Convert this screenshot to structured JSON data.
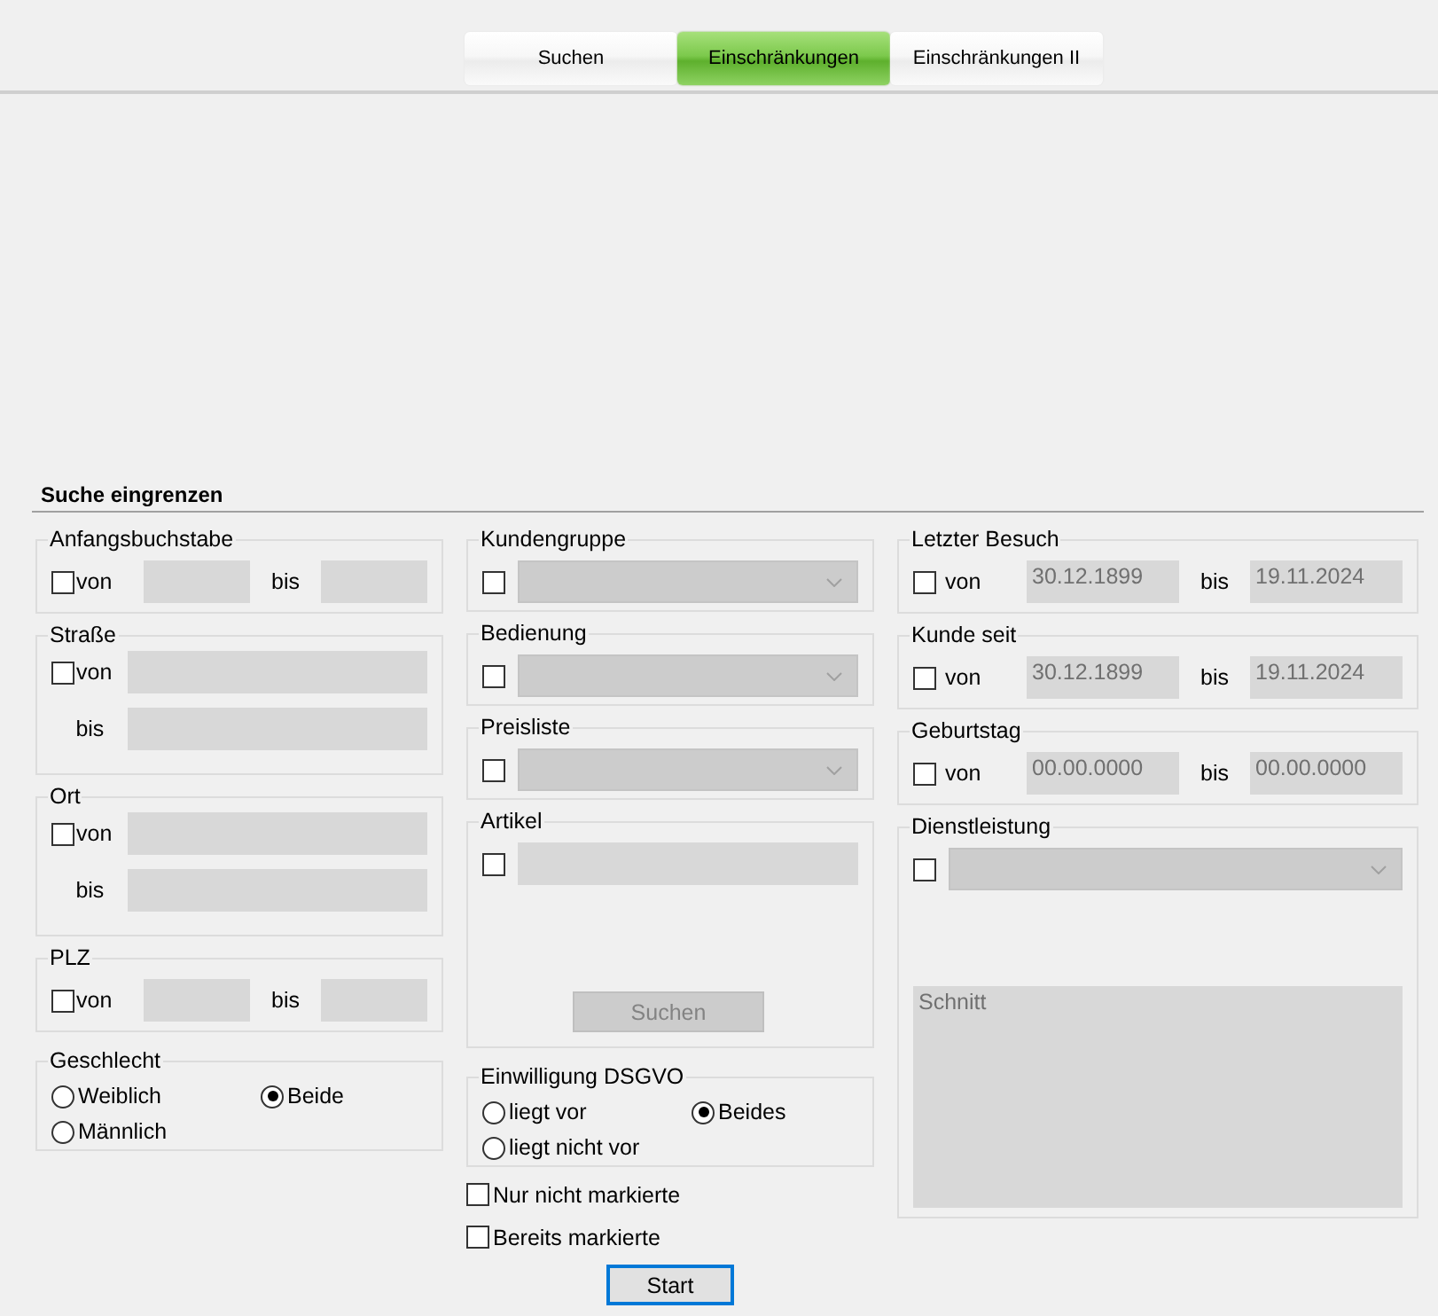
{
  "tabs": [
    {
      "label": "Suchen",
      "selected": false
    },
    {
      "label": "Einschränkungen",
      "selected": true
    },
    {
      "label": "Einschränkungen II",
      "selected": false
    }
  ],
  "section_title": "Suche eingrenzen",
  "columns": [
    {
      "groups": [
        {
          "kind": "range",
          "title": "Anfangsbuchstabe",
          "checkbox": {
            "label": "von",
            "checked": false
          },
          "from": {
            "disabled": true
          },
          "to_label": "bis",
          "to": {
            "disabled": true
          }
        },
        {
          "kind": "range_stacked",
          "title": "Straße",
          "checkbox": {
            "label": "von",
            "checked": false
          },
          "from": {
            "disabled": true
          },
          "to_label": "bis",
          "to": {
            "disabled": true
          }
        },
        {
          "kind": "range_stacked",
          "title": "Ort",
          "checkbox": {
            "label": "von",
            "checked": false
          },
          "from": {
            "disabled": true
          },
          "to_label": "bis",
          "to": {
            "disabled": true
          }
        },
        {
          "kind": "range",
          "title": "PLZ",
          "checkbox": {
            "label": "von",
            "checked": false
          },
          "from": {
            "disabled": true
          },
          "to_label": "bis",
          "to": {
            "disabled": true
          }
        },
        {
          "kind": "radio",
          "title": "Geschlecht",
          "options": [
            {
              "label": "Weiblich",
              "selected": false
            },
            {
              "label": "Beide",
              "selected": true
            },
            {
              "label": "Männlich",
              "selected": false
            }
          ]
        }
      ]
    },
    {
      "groups": [
        {
          "kind": "select",
          "title": "Kundengruppe",
          "checkbox": {
            "checked": false
          },
          "dropdown": {
            "disabled": true
          }
        },
        {
          "kind": "select",
          "title": "Bedienung",
          "checkbox": {
            "checked": false
          },
          "dropdown": {
            "disabled": true
          }
        },
        {
          "kind": "select",
          "title": "Preisliste",
          "checkbox": {
            "checked": false
          },
          "dropdown": {
            "disabled": true
          }
        },
        {
          "kind": "search",
          "title": "Artikel",
          "checkbox": {
            "checked": false
          },
          "field": {
            "disabled": true
          },
          "button": {
            "label": "Suchen",
            "disabled": true
          }
        },
        {
          "kind": "radio",
          "title": "Einwilligung DSGVO",
          "options": [
            {
              "label": "liegt vor",
              "selected": false
            },
            {
              "label": "Beides",
              "selected": true
            },
            {
              "label": "liegt nicht vor",
              "selected": false
            }
          ]
        },
        {
          "kind": "check",
          "label": "Nur nicht markierte",
          "checked": false
        },
        {
          "kind": "check",
          "label": "Bereits markierte",
          "checked": false
        },
        {
          "kind": "button",
          "label": "Start",
          "disabled": false,
          "default": true
        }
      ]
    },
    {
      "groups": [
        {
          "kind": "range",
          "title": "Letzter Besuch",
          "checkbox": {
            "label": "von",
            "checked": false
          },
          "from": {
            "value": "30.12.1899",
            "disabled": true
          },
          "to_label": "bis",
          "to": {
            "value": "19.11.2024",
            "disabled": true
          }
        },
        {
          "kind": "range",
          "title": "Kunde seit",
          "checkbox": {
            "label": "von",
            "checked": false
          },
          "from": {
            "value": "30.12.1899",
            "disabled": true
          },
          "to_label": "bis",
          "to": {
            "value": "19.11.2024",
            "disabled": true
          }
        },
        {
          "kind": "range",
          "title": "Geburtstag",
          "checkbox": {
            "label": "von",
            "checked": false
          },
          "from": {
            "value": "00.00.0000",
            "disabled": true
          },
          "to_label": "bis",
          "to": {
            "value": "00.00.0000",
            "disabled": true
          }
        },
        {
          "kind": "select_list",
          "title": "Dienstleistung",
          "checkbox": {
            "checked": false
          },
          "dropdown": {
            "disabled": true
          },
          "list": {
            "disabled": true,
            "items": [
              "Schnitt"
            ]
          }
        }
      ]
    }
  ]
}
